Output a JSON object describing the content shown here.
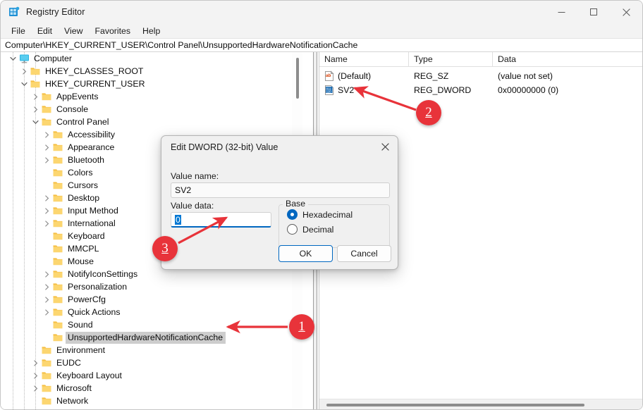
{
  "window": {
    "title": "Registry Editor",
    "icon": "registry-editor-icon",
    "controls": {
      "minimize": "–",
      "maximize": "□",
      "close": "✕"
    }
  },
  "menu": {
    "items": [
      "File",
      "Edit",
      "View",
      "Favorites",
      "Help"
    ]
  },
  "address": {
    "path": "Computer\\HKEY_CURRENT_USER\\Control Panel\\UnsupportedHardwareNotificationCache"
  },
  "tree": {
    "items": [
      {
        "label": "Computer",
        "depth": 0,
        "state": "expanded",
        "icon": "computer-icon",
        "selected": false
      },
      {
        "label": "HKEY_CLASSES_ROOT",
        "depth": 1,
        "state": "collapsed",
        "icon": "folder-icon",
        "selected": false
      },
      {
        "label": "HKEY_CURRENT_USER",
        "depth": 1,
        "state": "expanded",
        "icon": "folder-icon",
        "selected": false
      },
      {
        "label": "AppEvents",
        "depth": 2,
        "state": "collapsed",
        "icon": "folder-icon",
        "selected": false
      },
      {
        "label": "Console",
        "depth": 2,
        "state": "collapsed",
        "icon": "folder-icon",
        "selected": false
      },
      {
        "label": "Control Panel",
        "depth": 2,
        "state": "expanded",
        "icon": "folder-icon",
        "selected": false
      },
      {
        "label": "Accessibility",
        "depth": 3,
        "state": "collapsed",
        "icon": "folder-icon",
        "selected": false
      },
      {
        "label": "Appearance",
        "depth": 3,
        "state": "collapsed",
        "icon": "folder-icon",
        "selected": false
      },
      {
        "label": "Bluetooth",
        "depth": 3,
        "state": "collapsed",
        "icon": "folder-icon",
        "selected": false
      },
      {
        "label": "Colors",
        "depth": 3,
        "state": "leaf",
        "icon": "folder-icon",
        "selected": false
      },
      {
        "label": "Cursors",
        "depth": 3,
        "state": "leaf",
        "icon": "folder-icon",
        "selected": false
      },
      {
        "label": "Desktop",
        "depth": 3,
        "state": "collapsed",
        "icon": "folder-icon",
        "selected": false
      },
      {
        "label": "Input Method",
        "depth": 3,
        "state": "collapsed",
        "icon": "folder-icon",
        "selected": false
      },
      {
        "label": "International",
        "depth": 3,
        "state": "collapsed",
        "icon": "folder-icon",
        "selected": false
      },
      {
        "label": "Keyboard",
        "depth": 3,
        "state": "leaf",
        "icon": "folder-icon",
        "selected": false
      },
      {
        "label": "MMCPL",
        "depth": 3,
        "state": "leaf",
        "icon": "folder-icon",
        "selected": false
      },
      {
        "label": "Mouse",
        "depth": 3,
        "state": "leaf",
        "icon": "folder-icon",
        "selected": false
      },
      {
        "label": "NotifyIconSettings",
        "depth": 3,
        "state": "collapsed",
        "icon": "folder-icon",
        "selected": false
      },
      {
        "label": "Personalization",
        "depth": 3,
        "state": "collapsed",
        "icon": "folder-icon",
        "selected": false
      },
      {
        "label": "PowerCfg",
        "depth": 3,
        "state": "collapsed",
        "icon": "folder-icon",
        "selected": false
      },
      {
        "label": "Quick Actions",
        "depth": 3,
        "state": "collapsed",
        "icon": "folder-icon",
        "selected": false
      },
      {
        "label": "Sound",
        "depth": 3,
        "state": "leaf",
        "icon": "folder-icon",
        "selected": false
      },
      {
        "label": "UnsupportedHardwareNotificationCache",
        "depth": 3,
        "state": "leaf",
        "icon": "folder-icon",
        "selected": true
      },
      {
        "label": "Environment",
        "depth": 2,
        "state": "leaf",
        "icon": "folder-icon",
        "selected": false
      },
      {
        "label": "EUDC",
        "depth": 2,
        "state": "collapsed",
        "icon": "folder-icon",
        "selected": false
      },
      {
        "label": "Keyboard Layout",
        "depth": 2,
        "state": "collapsed",
        "icon": "folder-icon",
        "selected": false
      },
      {
        "label": "Microsoft",
        "depth": 2,
        "state": "collapsed",
        "icon": "folder-icon",
        "selected": false
      },
      {
        "label": "Network",
        "depth": 2,
        "state": "leaf",
        "icon": "folder-icon",
        "selected": false
      }
    ]
  },
  "list": {
    "columns": [
      "Name",
      "Type",
      "Data"
    ],
    "rows": [
      {
        "name": "(Default)",
        "type": "REG_SZ",
        "data": "(value not set)",
        "icon": "string-value-icon"
      },
      {
        "name": "SV2",
        "type": "REG_DWORD",
        "data": "0x00000000 (0)",
        "icon": "binary-value-icon"
      }
    ]
  },
  "dialog": {
    "title": "Edit DWORD (32-bit) Value",
    "close_icon": "✕",
    "value_name_label": "Value name:",
    "value_name": "SV2",
    "value_data_label": "Value data:",
    "value_data": "0",
    "base_legend": "Base",
    "base_options": [
      "Hexadecimal",
      "Decimal"
    ],
    "base_selected": "Hexadecimal",
    "ok_label": "OK",
    "cancel_label": "Cancel"
  },
  "annotations": {
    "accent_color": "#e8333a",
    "badges": [
      {
        "number": "1"
      },
      {
        "number": "2"
      },
      {
        "number": "3"
      }
    ]
  }
}
